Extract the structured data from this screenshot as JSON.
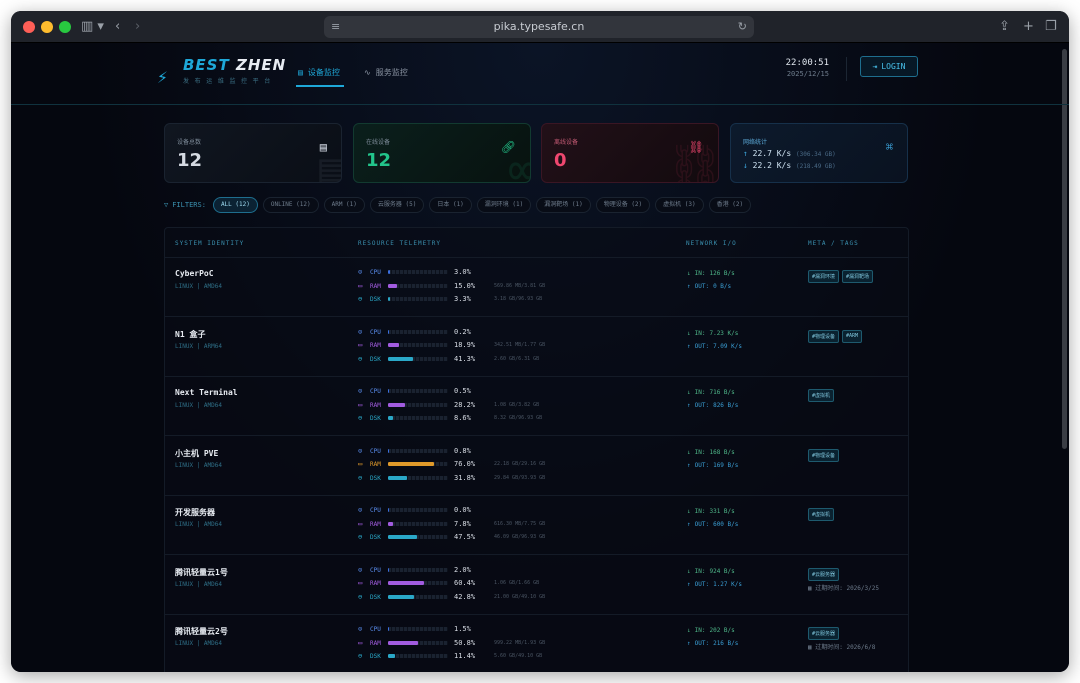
{
  "browser": {
    "url": "pika.typesafe.cn"
  },
  "brand": {
    "part1": "BEST",
    "part2": "ZHEN",
    "tagline": "发 布 运 维 监 控 平 台"
  },
  "nav": {
    "tab1": "设备监控",
    "tab2": "服务监控"
  },
  "clock": {
    "time": "22:00:51",
    "date": "2025/12/15"
  },
  "login": "LOGIN",
  "stats": [
    {
      "label": "设备总数",
      "value": "12"
    },
    {
      "label": "在线设备",
      "value": "12"
    },
    {
      "label": "离线设备",
      "value": "0"
    }
  ],
  "bandwidth": {
    "label": "网络统计",
    "up": "22.7 K/s",
    "up_total": "(306.34 GB)",
    "down": "22.2 K/s",
    "down_total": "(218.49 GB)"
  },
  "filters": {
    "label": "FILTERS:",
    "chips": [
      "ALL (12)",
      "ONLINE (12)",
      "ARM (1)",
      "云服务器 (5)",
      "日本 (1)",
      "漏洞环境 (1)",
      "漏洞靶场 (1)",
      "物理设备 (2)",
      "虚拟机 (3)",
      "香港 (2)"
    ]
  },
  "table": {
    "h1": "SYSTEM IDENTITY",
    "h2": "RESOURCE TELEMETRY",
    "h3": "NETWORK I/O",
    "h4": "META / TAGS"
  },
  "labels": {
    "cpu": "CPU",
    "ram": "RAM",
    "dsk": "DSK",
    "in": "IN:",
    "out": "OUT:"
  },
  "colors": {
    "cpu": "#3b6fe0",
    "ram_purple": "#a25ce0",
    "ram_orange": "#e09a2a",
    "dsk": "#2aa8c8",
    "accent": "#1ea8d8",
    "online": "#22c58b",
    "offline": "#ef476f"
  },
  "servers": [
    {
      "name": "CyberPoC",
      "os": "LINUX | AMD64",
      "cpu": 3.0,
      "cpu_t": "3.0%",
      "ram": 15.0,
      "ram_t": "15.0%",
      "ram_d": "569.86 MB/3.81 GB",
      "ram_c": "purple",
      "dsk": 3.3,
      "dsk_t": "3.3%",
      "dsk_d": "3.18 GB/96.93 GB",
      "in": "126 B/s",
      "out": "0 B/s",
      "tags": [
        "#漏洞环境",
        "#漏洞靶场"
      ],
      "exp": ""
    },
    {
      "name": "N1 盒子",
      "os": "LINUX | ARM64",
      "cpu": 0.2,
      "cpu_t": "0.2%",
      "ram": 18.9,
      "ram_t": "18.9%",
      "ram_d": "342.51 MB/1.77 GB",
      "ram_c": "purple",
      "dsk": 41.3,
      "dsk_t": "41.3%",
      "dsk_d": "2.60 GB/6.31 GB",
      "in": "7.23 K/s",
      "out": "7.09 K/s",
      "tags": [
        "#物理设备",
        "#ARM"
      ],
      "exp": ""
    },
    {
      "name": "Next Terminal",
      "os": "LINUX | AMD64",
      "cpu": 0.5,
      "cpu_t": "0.5%",
      "ram": 28.2,
      "ram_t": "28.2%",
      "ram_d": "1.08 GB/3.82 GB",
      "ram_c": "purple",
      "dsk": 8.6,
      "dsk_t": "8.6%",
      "dsk_d": "8.32 GB/96.93 GB",
      "in": "716 B/s",
      "out": "826 B/s",
      "tags": [
        "#虚拟机"
      ],
      "exp": ""
    },
    {
      "name": "小主机 PVE",
      "os": "LINUX | AMD64",
      "cpu": 0.8,
      "cpu_t": "0.8%",
      "ram": 76.0,
      "ram_t": "76.0%",
      "ram_d": "22.18 GB/29.16 GB",
      "ram_c": "orange",
      "dsk": 31.8,
      "dsk_t": "31.8%",
      "dsk_d": "29.84 GB/93.93 GB",
      "in": "168 B/s",
      "out": "169 B/s",
      "tags": [
        "#物理设备"
      ],
      "exp": ""
    },
    {
      "name": "开发服务器",
      "os": "LINUX | AMD64",
      "cpu": 0.0,
      "cpu_t": "0.0%",
      "ram": 7.8,
      "ram_t": "7.8%",
      "ram_d": "616.30 MB/7.75 GB",
      "ram_c": "purple",
      "dsk": 47.5,
      "dsk_t": "47.5%",
      "dsk_d": "46.09 GB/96.93 GB",
      "in": "331 B/s",
      "out": "600 B/s",
      "tags": [
        "#虚拟机"
      ],
      "exp": ""
    },
    {
      "name": "腾讯轻量云1号",
      "os": "LINUX | AMD64",
      "cpu": 2.0,
      "cpu_t": "2.0%",
      "ram": 60.4,
      "ram_t": "60.4%",
      "ram_d": "1.06 GB/1.66 GB",
      "ram_c": "purple",
      "dsk": 42.8,
      "dsk_t": "42.8%",
      "dsk_d": "21.00 GB/49.10 GB",
      "in": "924 B/s",
      "out": "1.27 K/s",
      "tags": [
        "#云服务器"
      ],
      "exp": "过期时间: 2026/3/25"
    },
    {
      "name": "腾讯轻量云2号",
      "os": "LINUX | AMD64",
      "cpu": 1.5,
      "cpu_t": "1.5%",
      "ram": 50.8,
      "ram_t": "50.8%",
      "ram_d": "999.22 MB/1.93 GB",
      "ram_c": "purple",
      "dsk": 11.4,
      "dsk_t": "11.4%",
      "dsk_d": "5.60 GB/49.10 GB",
      "in": "202 B/s",
      "out": "216 B/s",
      "tags": [
        "#云服务器"
      ],
      "exp": "过期时间: 2026/6/8"
    }
  ]
}
